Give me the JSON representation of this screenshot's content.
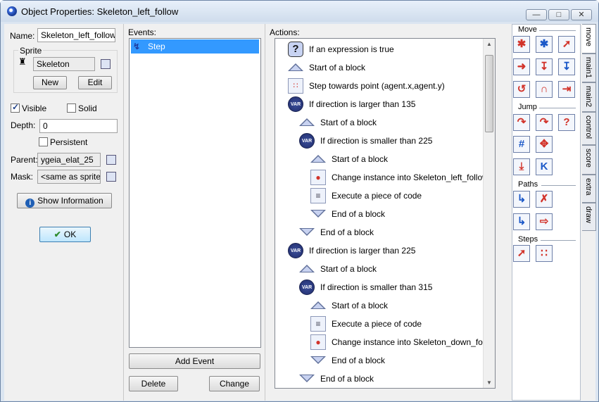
{
  "window": {
    "title": "Object Properties: Skeleton_left_follow",
    "min_label": "—",
    "max_label": "□",
    "close_label": "✕"
  },
  "left": {
    "name_label": "Name:",
    "name_value": "Skeleton_left_follow",
    "sprite_group": "Sprite",
    "sprite_value": "Skeleton",
    "new_label": "New",
    "edit_label": "Edit",
    "visible_label": "Visible",
    "visible_checked": true,
    "solid_label": "Solid",
    "solid_checked": false,
    "depth_label": "Depth:",
    "depth_value": "0",
    "persistent_label": "Persistent",
    "persistent_checked": false,
    "parent_label": "Parent:",
    "parent_value": "ygeia_elat_25",
    "mask_label": "Mask:",
    "mask_value": "<same as sprite>",
    "show_info_label": "Show Information",
    "ok_label": "OK"
  },
  "events": {
    "label": "Events:",
    "items": [
      "Step"
    ],
    "add_label": "Add Event",
    "delete_label": "Delete",
    "change_label": "Change"
  },
  "actions": {
    "label": "Actions:",
    "items": [
      {
        "icon": "question-icon",
        "indent": 0,
        "text": "If an expression is true"
      },
      {
        "icon": "start-block-icon",
        "indent": 0,
        "text": "Start of a block"
      },
      {
        "icon": "step-towards-icon",
        "indent": 0,
        "text": "Step towards point (agent.x,agent.y)"
      },
      {
        "icon": "var-icon",
        "indent": 0,
        "text": "If direction is larger than 135"
      },
      {
        "icon": "start-block-icon",
        "indent": 1,
        "text": "Start of a block"
      },
      {
        "icon": "var-icon",
        "indent": 1,
        "text": "If direction is smaller than 225"
      },
      {
        "icon": "start-block-icon",
        "indent": 2,
        "text": "Start of a block"
      },
      {
        "icon": "change-instance-icon",
        "indent": 2,
        "text": "Change instance into Skeleton_left_follow"
      },
      {
        "icon": "code-icon",
        "indent": 2,
        "text": "Execute a piece of code"
      },
      {
        "icon": "end-block-icon",
        "indent": 2,
        "text": "End of a block"
      },
      {
        "icon": "end-block-icon",
        "indent": 1,
        "text": "End of a block"
      },
      {
        "icon": "var-icon",
        "indent": 0,
        "text": "If direction is larger than 225"
      },
      {
        "icon": "start-block-icon",
        "indent": 1,
        "text": "Start of a block"
      },
      {
        "icon": "var-icon",
        "indent": 1,
        "text": "If direction is smaller than 315"
      },
      {
        "icon": "start-block-icon",
        "indent": 2,
        "text": "Start of a block"
      },
      {
        "icon": "code-icon",
        "indent": 2,
        "text": "Execute a piece of code"
      },
      {
        "icon": "change-instance-icon",
        "indent": 2,
        "text": "Change instance into Skeleton_down_follow"
      },
      {
        "icon": "end-block-icon",
        "indent": 2,
        "text": "End of a block"
      },
      {
        "icon": "end-block-icon",
        "indent": 1,
        "text": "End of a block"
      }
    ]
  },
  "toolbox": {
    "groups": [
      "Move",
      "Jump",
      "Paths",
      "Steps"
    ],
    "tabs": [
      "move",
      "main1",
      "main2",
      "control",
      "score",
      "extra",
      "draw"
    ]
  }
}
